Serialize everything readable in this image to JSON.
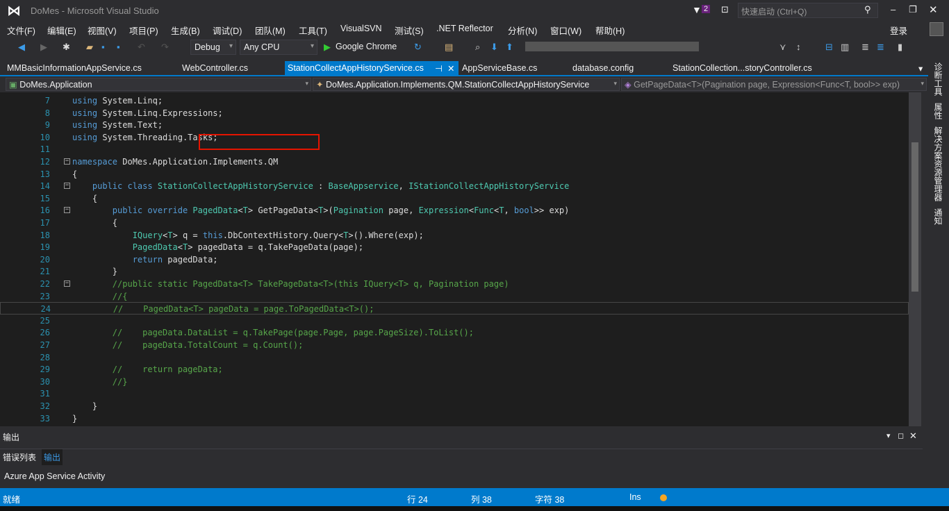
{
  "window": {
    "title": "DoMes - Microsoft Visual Studio",
    "notification_count": "2",
    "quick_launch_placeholder": "快速启动 (Ctrl+Q)",
    "signin": "登录"
  },
  "menu": [
    "文件(F)",
    "编辑(E)",
    "视图(V)",
    "项目(P)",
    "生成(B)",
    "调试(D)",
    "团队(M)",
    "工具(T)",
    "VisualSVN",
    "测试(S)",
    ".NET Reflector",
    "分析(N)",
    "窗口(W)",
    "帮助(H)"
  ],
  "toolbar": {
    "config": "Debug",
    "platform": "Any CPU",
    "run_target": "Google Chrome"
  },
  "tabs": [
    {
      "label": "MMBasicInformationAppService.cs"
    },
    {
      "label": "WebController.cs"
    },
    {
      "label": "StationCollectAppHistoryService.cs",
      "active": true
    },
    {
      "label": "AppServiceBase.cs"
    },
    {
      "label": "database.config"
    },
    {
      "label": "StationCollection...storyController.cs"
    }
  ],
  "nav": {
    "project": "DoMes.Application",
    "type": "DoMes.Application.Implements.QM.StationCollectAppHistoryService",
    "member": "GetPageData<T>(Pagination page, Expression<Func<T, bool>> exp)"
  },
  "code": [
    {
      "n": "7",
      "t": [
        [
          "kw",
          "using"
        ],
        [
          "",
          "System.Linq;"
        ]
      ]
    },
    {
      "n": "8",
      "t": [
        [
          "kw",
          "using"
        ],
        [
          "",
          "System.Linq.Expressions;"
        ]
      ]
    },
    {
      "n": "9",
      "t": [
        [
          "kw",
          "using"
        ],
        [
          "",
          "System.Text;"
        ]
      ]
    },
    {
      "n": "10",
      "t": [
        [
          "kw",
          "using"
        ],
        [
          "",
          "System.Threading.Tasks;"
        ]
      ]
    },
    {
      "n": "11",
      "t": []
    },
    {
      "n": "12",
      "fold": true,
      "t": [
        [
          "kw",
          "namespace"
        ],
        [
          "",
          " DoMes.Application.Implements.QM"
        ]
      ]
    },
    {
      "n": "13",
      "t": [
        [
          "",
          "{"
        ]
      ]
    },
    {
      "n": "14",
      "fold": true,
      "t": [
        [
          "",
          "    "
        ],
        [
          "kw",
          "public class"
        ],
        [
          "",
          " "
        ],
        [
          "ty",
          "StationCollectAppHistoryService"
        ],
        [
          "",
          " : "
        ],
        [
          "ty",
          "BaseAppservice"
        ],
        [
          "",
          ", "
        ],
        [
          "ty",
          "IStationCollectAppHistoryService"
        ]
      ]
    },
    {
      "n": "15",
      "t": [
        [
          "",
          "    {"
        ]
      ]
    },
    {
      "n": "16",
      "fold": true,
      "t": [
        [
          "",
          "        "
        ],
        [
          "kw",
          "public override"
        ],
        [
          "",
          " "
        ],
        [
          "ty",
          "PagedData"
        ],
        [
          "",
          "<"
        ],
        [
          "ty",
          "T"
        ],
        [
          "",
          "> GetPageData<"
        ],
        [
          "ty",
          "T"
        ],
        [
          "",
          ">("
        ],
        [
          "ty",
          "Pagination"
        ],
        [
          "",
          " page, "
        ],
        [
          "ty",
          "Expression"
        ],
        [
          "",
          "<"
        ],
        [
          "ty",
          "Func"
        ],
        [
          "",
          "<"
        ],
        [
          "ty",
          "T"
        ],
        [
          "",
          ", "
        ],
        [
          "kw",
          "bool"
        ],
        [
          "",
          ">> exp)"
        ]
      ]
    },
    {
      "n": "17",
      "t": [
        [
          "",
          "        {"
        ]
      ]
    },
    {
      "n": "18",
      "t": [
        [
          "",
          "            "
        ],
        [
          "ty",
          "IQuery"
        ],
        [
          "",
          "<"
        ],
        [
          "ty",
          "T"
        ],
        [
          "",
          "> q = "
        ],
        [
          "kw",
          "this"
        ],
        [
          "",
          ".DbContextHistory.Query<"
        ],
        [
          "ty",
          "T"
        ],
        [
          "",
          ">().Where(exp);"
        ]
      ]
    },
    {
      "n": "19",
      "t": [
        [
          "",
          "            "
        ],
        [
          "ty",
          "PagedData"
        ],
        [
          "",
          "<"
        ],
        [
          "ty",
          "T"
        ],
        [
          "",
          "> pagedData = q.TakePageData(page);"
        ]
      ]
    },
    {
      "n": "20",
      "t": [
        [
          "",
          "            "
        ],
        [
          "kw",
          "return"
        ],
        [
          "",
          " pagedData;"
        ]
      ]
    },
    {
      "n": "21",
      "t": [
        [
          "",
          "        }"
        ]
      ]
    },
    {
      "n": "22",
      "fold": true,
      "t": [
        [
          "",
          "        "
        ],
        [
          "cm",
          "//public static PagedData<T> TakePageData<T>(this IQuery<T> q, Pagination page)"
        ]
      ]
    },
    {
      "n": "23",
      "t": [
        [
          "",
          "        "
        ],
        [
          "cm",
          "//{"
        ]
      ]
    },
    {
      "n": "24",
      "cur": true,
      "t": [
        [
          "",
          "        "
        ],
        [
          "cm",
          "//    PagedData<T> pageData = page.ToPagedData<T>();"
        ]
      ]
    },
    {
      "n": "25",
      "t": []
    },
    {
      "n": "26",
      "t": [
        [
          "",
          "        "
        ],
        [
          "cm",
          "//    pageData.DataList = q.TakePage(page.Page, page.PageSize).ToList();"
        ]
      ]
    },
    {
      "n": "27",
      "t": [
        [
          "",
          "        "
        ],
        [
          "cm",
          "//    pageData.TotalCount = q.Count();"
        ]
      ]
    },
    {
      "n": "28",
      "t": []
    },
    {
      "n": "29",
      "t": [
        [
          "",
          "        "
        ],
        [
          "cm",
          "//    return pageData;"
        ]
      ]
    },
    {
      "n": "30",
      "t": [
        [
          "",
          "        "
        ],
        [
          "cm",
          "//}"
        ]
      ]
    },
    {
      "n": "31",
      "t": []
    },
    {
      "n": "32",
      "t": [
        [
          "",
          "    }"
        ]
      ]
    },
    {
      "n": "33",
      "t": [
        [
          "",
          "}"
        ]
      ]
    }
  ],
  "right_tabs": [
    "诊断工具",
    "属性",
    "解决方案资源管理器",
    "通知"
  ],
  "output": {
    "title": "输出",
    "tabs": [
      "错误列表",
      "输出"
    ],
    "active_tab": "输出"
  },
  "azure": "Azure App Service Activity",
  "status": {
    "ready": "就绪",
    "line": "行 24",
    "col": "列 38",
    "char": "字符 38",
    "mode": "Ins"
  },
  "colors": {
    "accent": "#007acc",
    "keyword": "#569cd6",
    "type": "#4ec9b0",
    "comment": "#57a64a",
    "highlight_box": "#e51400"
  }
}
